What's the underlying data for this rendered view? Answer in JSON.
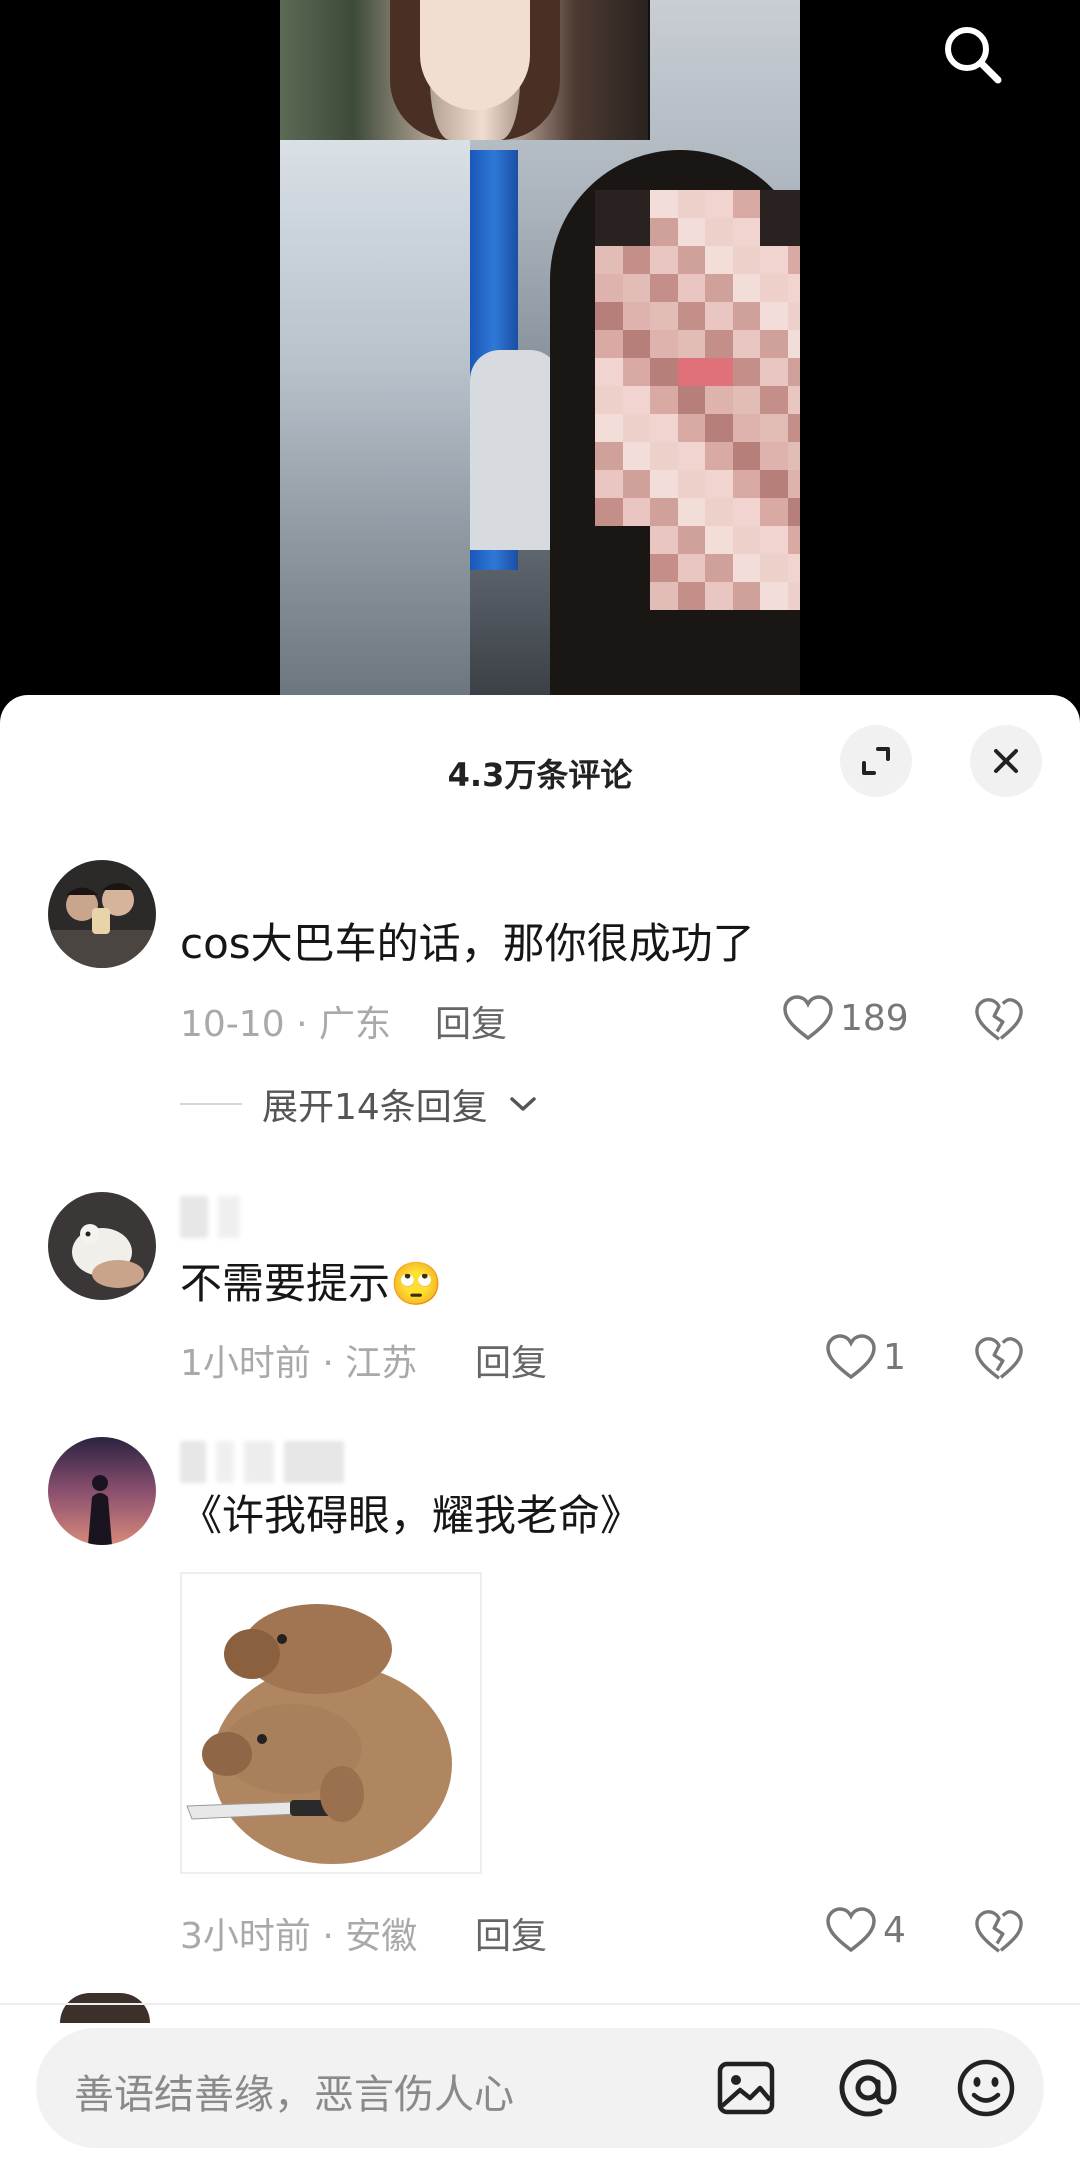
{
  "header": {
    "search_icon": "search-icon"
  },
  "comments_sheet": {
    "title": "4.3万条评论",
    "expand_icon": "expand-icon",
    "close_icon": "close-icon"
  },
  "comments": [
    {
      "text": "cos大巴车的话，那你很成功了",
      "date": "10-10",
      "location": "广东",
      "reply_label": "回复",
      "likes": "189",
      "expand_replies": "展开14条回复"
    },
    {
      "text": "不需要提示",
      "emoji": "🙄",
      "date": "1小时前",
      "location": "江苏",
      "reply_label": "回复",
      "likes": "1"
    },
    {
      "text": "《许我碍眼，耀我老命》",
      "sticker": "capybara-with-knife-sticker",
      "date": "3小时前",
      "location": "安徽",
      "reply_label": "回复",
      "likes": "4"
    }
  ],
  "input_bar": {
    "placeholder": "善语结善缘，恶言伤人心",
    "icons": [
      "image-icon",
      "at-icon",
      "emoji-icon"
    ]
  },
  "colors": {
    "sheet_bg": "#ffffff",
    "text_primary": "#161616",
    "text_meta": "#a9a9a9",
    "input_bg": "#f2f2f2"
  }
}
